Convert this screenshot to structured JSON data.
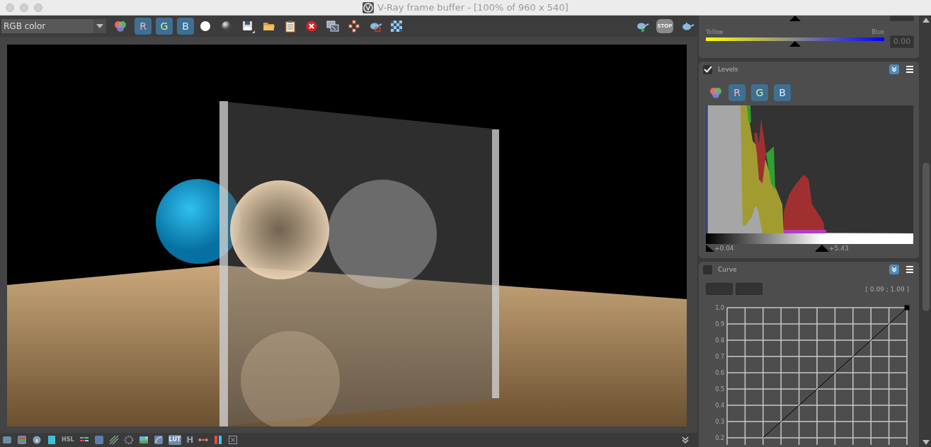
{
  "window": {
    "title": "V-Ray frame buffer - [100% of 960 x 540]"
  },
  "toolbar": {
    "display_channel": {
      "value": "RGB color"
    },
    "channels": [
      {
        "label": "R",
        "selected": true
      },
      {
        "label": "G",
        "selected": true
      },
      {
        "label": "B",
        "selected": true
      }
    ],
    "stop_label": "STOP"
  },
  "side_panel": {
    "color_balance": {
      "left_label": "Yellow",
      "right_label": "Blue",
      "level": 0.5,
      "value": "0.00"
    },
    "levels": {
      "title": "Levels",
      "enabled": true,
      "channels": [
        {
          "label": "R",
          "selected": true
        },
        {
          "label": "G",
          "selected": true
        },
        {
          "label": "B",
          "selected": true
        }
      ],
      "black_point": {
        "level": 0.0,
        "reading": "+0.04"
      },
      "white_point": {
        "level": 0.56,
        "reading": "+5.43"
      }
    },
    "curve": {
      "title": "Curve",
      "enabled": false,
      "coordinates": "[ 0.09 ; 1.09 ]",
      "axis_labels": [
        "1.0",
        "0.9",
        "0.8",
        "0.7",
        "0.6",
        "0.5",
        "0.4",
        "0.3",
        "0.2"
      ]
    }
  },
  "bottom_toolbar": {
    "hsl_label": "HSL",
    "lut_label": "LUT",
    "h_label": "H"
  }
}
